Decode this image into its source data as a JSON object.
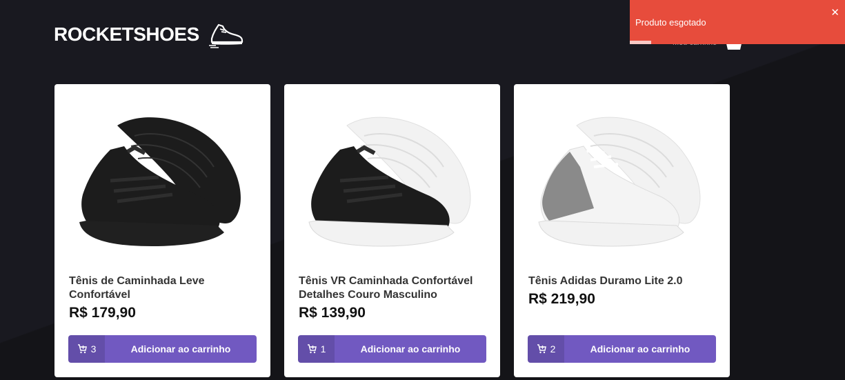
{
  "app": {
    "logo_text": "ROCKETSHOES",
    "logo_icon": "sneaker-icon",
    "cart_label": "Meu carrinho",
    "cart_icon": "shopping-basket-icon"
  },
  "products": [
    {
      "title": "Tênis de Caminhada Leve Confortável",
      "price": "R$ 179,90",
      "cart_amount": "3",
      "button_label": "Adicionar ao carrinho",
      "image": "black-sneaker",
      "colors": {
        "upper": "#1c1c1c",
        "sole": "#202020",
        "accent": "#2e2e2e"
      }
    },
    {
      "title": "Tênis VR Caminhada Confortável Detalhes Couro Masculino",
      "price": "R$ 139,90",
      "cart_amount": "1",
      "button_label": "Adicionar ao carrinho",
      "image": "black-white-sneaker",
      "colors": {
        "upper": "#1c1c1c",
        "sole": "#f2f2f2",
        "accent": "#2e2e2e"
      }
    },
    {
      "title": "Tênis Adidas Duramo Lite 2.0",
      "price": "R$ 219,90",
      "cart_amount": "2",
      "button_label": "Adicionar ao carrinho",
      "image": "white-grey-sneaker",
      "colors": {
        "upper": "#f4f4f4",
        "sole": "#f2f2f2",
        "accent": "#8a8a8a"
      }
    }
  ],
  "toast": {
    "message": "Produto esgotado",
    "close_label": "✕",
    "type": "error",
    "color": "#e74c3c",
    "progress": 0.1
  },
  "theme": {
    "background": "#191920",
    "accent": "#7159c1"
  }
}
